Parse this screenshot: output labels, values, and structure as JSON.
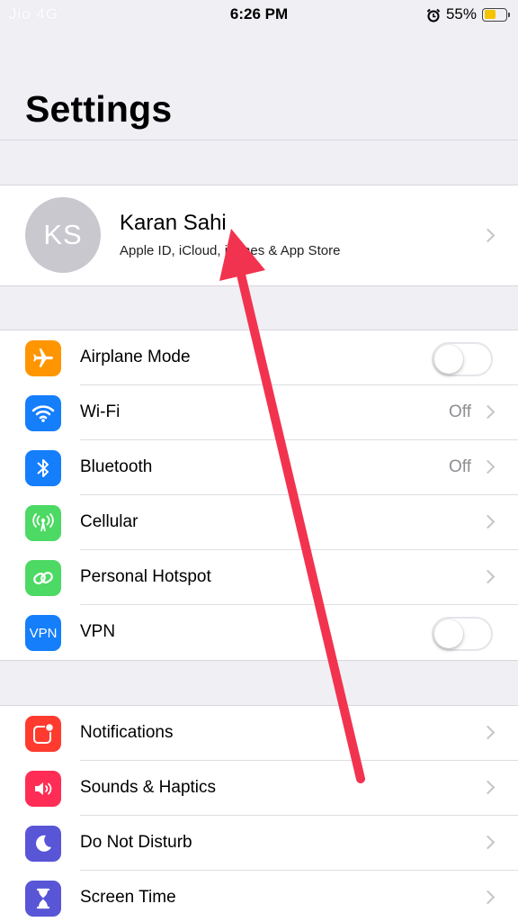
{
  "status": {
    "carrier": "Jio 4G",
    "time": "6:26 PM",
    "battery": "55%",
    "battery_level": 0.55
  },
  "page": {
    "title": "Settings"
  },
  "profile": {
    "initials": "KS",
    "name": "Karan Sahi",
    "subtitle": "Apple ID, iCloud, iTunes & App Store"
  },
  "colors": {
    "airplane": "#ff9500",
    "wifi": "#147efb",
    "bluetooth": "#147efb",
    "cellular": "#4cd964",
    "hotspot": "#4cd964",
    "vpn": "#147efb",
    "notifications": "#ff3b30",
    "sounds": "#ff2d55",
    "dnd": "#5856d6",
    "screentime": "#5856d6",
    "annotation_arrow": "#f2334f"
  },
  "group1": [
    {
      "label": "Airplane Mode",
      "icon": "airplane-icon",
      "toggle": "off"
    },
    {
      "label": "Wi-Fi",
      "icon": "wifi-icon",
      "value": "Off"
    },
    {
      "label": "Bluetooth",
      "icon": "bluetooth-icon",
      "value": "Off"
    },
    {
      "label": "Cellular",
      "icon": "cellular-icon"
    },
    {
      "label": "Personal Hotspot",
      "icon": "hotspot-icon"
    },
    {
      "label": "VPN",
      "icon": "vpn-icon",
      "icon_text": "VPN",
      "toggle": "off"
    }
  ],
  "group2": [
    {
      "label": "Notifications",
      "icon": "notifications-icon"
    },
    {
      "label": "Sounds & Haptics",
      "icon": "sounds-icon"
    },
    {
      "label": "Do Not Disturb",
      "icon": "moon-icon"
    },
    {
      "label": "Screen Time",
      "icon": "hourglass-icon"
    }
  ]
}
